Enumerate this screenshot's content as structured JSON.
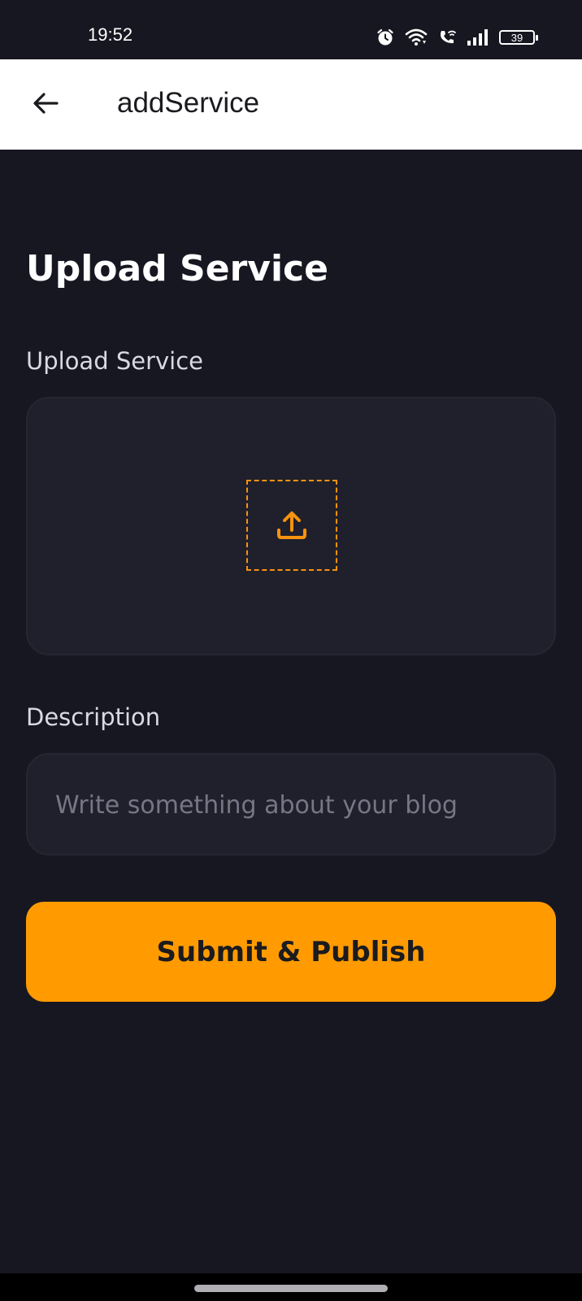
{
  "status_bar": {
    "time": "19:52",
    "battery": "39",
    "icons": [
      "alarm-icon",
      "wifi-icon",
      "wifi-call-icon",
      "signal-icon",
      "battery-icon"
    ]
  },
  "app_bar": {
    "title": "addService",
    "back_icon": "arrow-left-icon"
  },
  "main": {
    "heading": "Upload Service",
    "upload": {
      "label": "Upload Service",
      "icon": "upload-icon"
    },
    "description": {
      "label": "Description",
      "value": "",
      "placeholder": "Write something about your blog"
    },
    "submit_label": "Submit & Publish"
  },
  "colors": {
    "background": "#171721",
    "surface": "#20202c",
    "accent": "#ff9b00",
    "upload_icon": "#f7930f"
  }
}
